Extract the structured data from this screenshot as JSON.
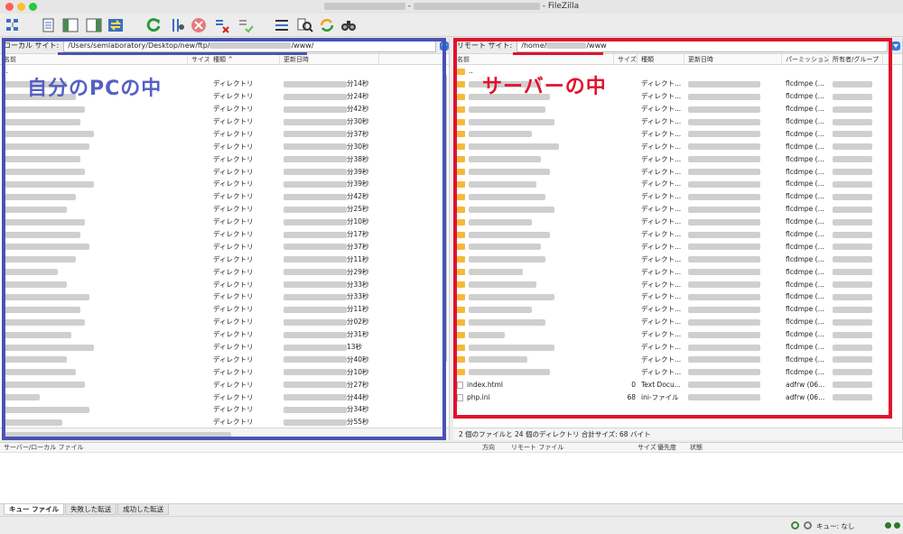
{
  "window": {
    "title_suffix": " - FileZilla"
  },
  "colors": {
    "accent_blue": "#4a52b3",
    "accent_red": "#e0122c",
    "folder": "#f5b93a"
  },
  "toolbar": {
    "icons": [
      "site-manager-icon",
      "message-log-icon",
      "local-tree-icon",
      "remote-tree-icon",
      "transfer-queue-icon",
      "refresh-icon",
      "process-queue-icon",
      "cancel-icon",
      "disconnect-icon",
      "reconnect-icon",
      "filter-icon",
      "compare-icon",
      "sync-browse-icon",
      "search-icon"
    ]
  },
  "local": {
    "site_label": "ローカル サイト:",
    "path_prefix": "/Users/semlaboratory/Desktop/new/ftp/",
    "path_suffix": "/www/",
    "columns": {
      "name": "名前",
      "size": "サイズ",
      "type": "種類",
      "modified": "更新日時"
    },
    "up_row": "..",
    "dir_type": "ディレクトリ",
    "rows_seconds": [
      "分14秒",
      "分24秒",
      "分42秒",
      "分30秒",
      "分37秒",
      "分30秒",
      "分38秒",
      "分39秒",
      "分39秒",
      "分42秒",
      "分25秒",
      "分10秒",
      "分17秒",
      "分37秒",
      "分11秒",
      "分29秒",
      "分33秒",
      "分33秒",
      "分11秒",
      "分02秒",
      "分31秒",
      "13秒",
      "分40秒",
      "分10秒",
      "分27秒",
      "分44秒",
      "分34秒",
      "分55秒"
    ],
    "annotation": "自分のPCの中"
  },
  "remote": {
    "site_label": "リモート サイト:",
    "path_prefix": "/home/",
    "path_suffix": "/www",
    "columns": {
      "name": "名前",
      "size": "サイズ",
      "type": "種類",
      "modified": "更新日時",
      "perm": "パーミッション",
      "owner": "所有者/グループ"
    },
    "up_row": "..",
    "dir_type": "ディレクト...",
    "owner_dir": "flcdmpe (...",
    "dir_count": 24,
    "files": [
      {
        "name": "index.html",
        "size": "0",
        "type": "Text Docu...",
        "owner": "adfrw (06..."
      },
      {
        "name": "php.ini",
        "size": "68",
        "type": "ini-ファイル",
        "owner": "adfrw (06..."
      }
    ],
    "status": "2 個のファイルと 24 個のディレクトリ 合計サイズ: 68 バイト",
    "annotation": "サーバーの中"
  },
  "queue": {
    "columns": {
      "server_file": "サーバー/ローカル ファイル",
      "direction": "方向",
      "remote_file": "リモート ファイル",
      "size": "サイズ",
      "priority": "優先度",
      "state": "状態"
    },
    "tabs": [
      "キュー ファイル",
      "失敗した転送",
      "成功した転送"
    ],
    "status_text": "キュー: なし"
  }
}
